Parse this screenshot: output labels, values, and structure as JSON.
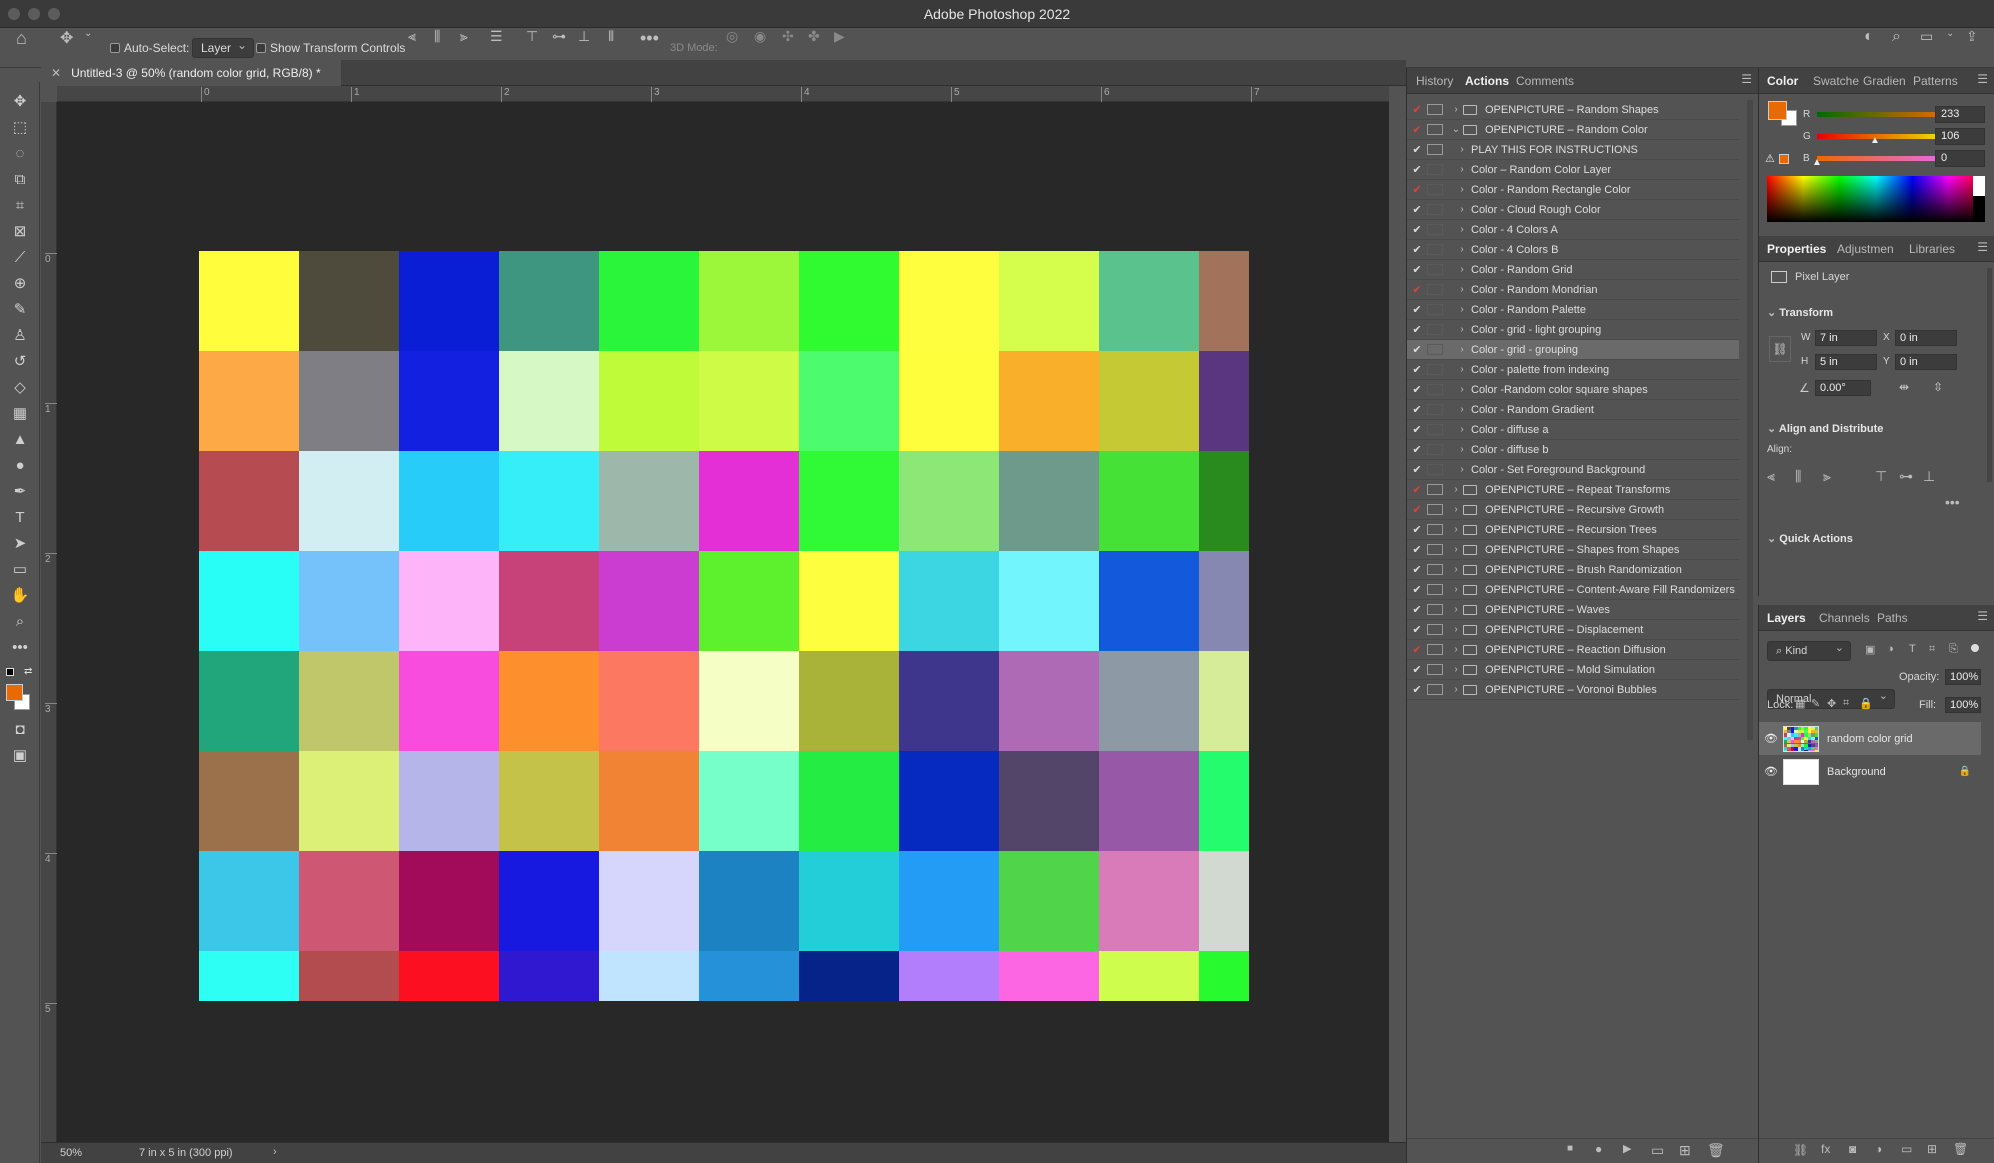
{
  "app": {
    "title": "Adobe Photoshop 2022"
  },
  "options_bar": {
    "auto_select_label": "Auto-Select:",
    "auto_select_value": "Layer",
    "show_transform_label": "Show Transform Controls",
    "mode_3d_label": "3D Mode:"
  },
  "document": {
    "tab_title": "Untitled-3 @ 50% (random color grid, RGB/8) *",
    "zoom": "50%",
    "doc_size": "7 in x 5 in (300 ppi)",
    "ruler_h": [
      "0",
      "1",
      "2",
      "3",
      "4",
      "5",
      "6",
      "7"
    ],
    "ruler_v": [
      "0",
      "1",
      "2",
      "3",
      "4",
      "5"
    ],
    "grid": {
      "cols": 10.5,
      "rows": 7.5,
      "colors": [
        [
          "#fffd3c",
          "#4e4b3c",
          "#0a1ed6",
          "#3e9680",
          "#2af53a",
          "#9cf63a",
          "#30fb30",
          "#fefd3e",
          "#d5fd4c",
          "#59c28d",
          "#a2725a"
        ],
        [
          "#fdaa46",
          "#7f7e84",
          "#1320df",
          "#d6f8c4",
          "#bffb39",
          "#cefb46",
          "#4dfc6e",
          "#fefe3c",
          "#f9af2a",
          "#c5c934",
          "#5b3680"
        ],
        [
          "#b64c52",
          "#d3eef2",
          "#28ccf9",
          "#36eef8",
          "#9db8aa",
          "#e42fd6",
          "#30fa35",
          "#8de776",
          "#6e9a8b",
          "#46e137",
          "#298a1d"
        ],
        [
          "#28fdf6",
          "#75c1fa",
          "#fdb4f8",
          "#c8427a",
          "#cb3dd1",
          "#5df02c",
          "#fdfe3d",
          "#3cd6e2",
          "#72f5fd",
          "#1259dc",
          "#8688b1"
        ],
        [
          "#21a67c",
          "#c0c76a",
          "#f84cde",
          "#fd902c",
          "#fd7861",
          "#f5fec4",
          "#a9b339",
          "#3e358d",
          "#af6ab6",
          "#8d9aa5",
          "#d6ec98"
        ],
        [
          "#9a714a",
          "#dcf078",
          "#b6b5ea",
          "#c4c248",
          "#f18335",
          "#77ffc9",
          "#25ec42",
          "#0629bf",
          "#524569",
          "#9858a8",
          "#24fb6d"
        ],
        [
          "#3cc6e8",
          "#ce5873",
          "#a10b5a",
          "#1719e1",
          "#d6d6fd",
          "#1c82c1",
          "#24ced8",
          "#239cf5",
          "#50d54a",
          "#d97ab9",
          "#d2d9d0"
        ],
        [
          "#2efff5",
          "#b24c4f",
          "#fd0f22",
          "#3018d0",
          "#c0e4fd",
          "#2491d9",
          "#06238a",
          "#b27efc",
          "#fd66e3",
          "#cffd4e",
          "#27fa2e"
        ]
      ]
    }
  },
  "actions_panel": {
    "tabs": [
      "History",
      "Actions",
      "Comments"
    ],
    "rows": [
      {
        "check": "red",
        "dialog": true,
        "expanded": false,
        "folder": true,
        "indent": 0,
        "label": "OPENPICTURE – Random Shapes"
      },
      {
        "check": "red",
        "dialog": true,
        "expanded": true,
        "folder": true,
        "indent": 0,
        "label": "OPENPICTURE – Random Color"
      },
      {
        "check": "white",
        "dialog": true,
        "expanded": false,
        "folder": false,
        "indent": 1,
        "label": "PLAY THIS FOR INSTRUCTIONS"
      },
      {
        "check": "white",
        "dialog": false,
        "expanded": false,
        "folder": false,
        "indent": 1,
        "label": "Color – Random Color Layer"
      },
      {
        "check": "red",
        "dialog": false,
        "expanded": false,
        "folder": false,
        "indent": 1,
        "label": "Color - Random Rectangle Color"
      },
      {
        "check": "white",
        "dialog": false,
        "expanded": false,
        "folder": false,
        "indent": 1,
        "label": "Color - Cloud Rough Color"
      },
      {
        "check": "white",
        "dialog": false,
        "expanded": false,
        "folder": false,
        "indent": 1,
        "label": "Color - 4 Colors A"
      },
      {
        "check": "white",
        "dialog": false,
        "expanded": false,
        "folder": false,
        "indent": 1,
        "label": "Color - 4 Colors B"
      },
      {
        "check": "white",
        "dialog": false,
        "expanded": false,
        "folder": false,
        "indent": 1,
        "label": "Color - Random Grid"
      },
      {
        "check": "red",
        "dialog": false,
        "expanded": false,
        "folder": false,
        "indent": 1,
        "label": "Color - Random Mondrian"
      },
      {
        "check": "white",
        "dialog": false,
        "expanded": false,
        "folder": false,
        "indent": 1,
        "label": "Color - Random Palette"
      },
      {
        "check": "white",
        "dialog": false,
        "expanded": false,
        "folder": false,
        "indent": 1,
        "label": "Color - grid - light grouping"
      },
      {
        "check": "white",
        "dialog": false,
        "expanded": false,
        "folder": false,
        "indent": 1,
        "label": "Color - grid - grouping",
        "selected": true
      },
      {
        "check": "white",
        "dialog": false,
        "expanded": false,
        "folder": false,
        "indent": 1,
        "label": "Color - palette from indexing"
      },
      {
        "check": "white",
        "dialog": false,
        "expanded": false,
        "folder": false,
        "indent": 1,
        "label": "Color -Random color square shapes"
      },
      {
        "check": "white",
        "dialog": false,
        "expanded": false,
        "folder": false,
        "indent": 1,
        "label": "Color - Random Gradient"
      },
      {
        "check": "white",
        "dialog": false,
        "expanded": false,
        "folder": false,
        "indent": 1,
        "label": "Color - diffuse a"
      },
      {
        "check": "white",
        "dialog": false,
        "expanded": false,
        "folder": false,
        "indent": 1,
        "label": "Color - diffuse b"
      },
      {
        "check": "white",
        "dialog": false,
        "expanded": false,
        "folder": false,
        "indent": 1,
        "label": "Color - Set Foreground Background"
      },
      {
        "check": "red",
        "dialog": true,
        "expanded": false,
        "folder": true,
        "indent": 0,
        "label": "OPENPICTURE – Repeat Transforms"
      },
      {
        "check": "red",
        "dialog": true,
        "expanded": false,
        "folder": true,
        "indent": 0,
        "label": "OPENPICTURE – Recursive Growth"
      },
      {
        "check": "white",
        "dialog": true,
        "expanded": false,
        "folder": true,
        "indent": 0,
        "label": "OPENPICTURE – Recursion Trees"
      },
      {
        "check": "white",
        "dialog": true,
        "expanded": false,
        "folder": true,
        "indent": 0,
        "label": "OPENPICTURE – Shapes from Shapes"
      },
      {
        "check": "white",
        "dialog": true,
        "expanded": false,
        "folder": true,
        "indent": 0,
        "label": "OPENPICTURE – Brush Randomization"
      },
      {
        "check": "white",
        "dialog": true,
        "expanded": false,
        "folder": true,
        "indent": 0,
        "label": "OPENPICTURE – Content-Aware Fill Randomizers"
      },
      {
        "check": "white",
        "dialog": true,
        "expanded": false,
        "folder": true,
        "indent": 0,
        "label": "OPENPICTURE – Waves"
      },
      {
        "check": "white",
        "dialog": true,
        "expanded": false,
        "folder": true,
        "indent": 0,
        "label": "OPENPICTURE – Displacement"
      },
      {
        "check": "red",
        "dialog": true,
        "expanded": false,
        "folder": true,
        "indent": 0,
        "label": "OPENPICTURE – Reaction Diffusion"
      },
      {
        "check": "white",
        "dialog": true,
        "expanded": false,
        "folder": true,
        "indent": 0,
        "label": "OPENPICTURE – Mold Simulation"
      },
      {
        "check": "white",
        "dialog": true,
        "expanded": false,
        "folder": true,
        "indent": 0,
        "label": "OPENPICTURE – Voronoi Bubbles"
      }
    ]
  },
  "color_panel": {
    "tabs": [
      "Color",
      "Swatche",
      "Gradien",
      "Patterns"
    ],
    "r_label": "R",
    "g_label": "G",
    "b_label": "B",
    "r": "233",
    "g": "106",
    "b": "0",
    "r_fraction": 0.914,
    "g_fraction": 0.416,
    "b_fraction": 0.0,
    "foreground": "#e96a00"
  },
  "properties_panel": {
    "tabs": [
      "Properties",
      "Adjustmen",
      "Libraries"
    ],
    "layer_type": "Pixel Layer",
    "transform_title": "Transform",
    "w_label": "W",
    "w": "7 in",
    "x_label": "X",
    "x": "0 in",
    "h_label": "H",
    "h": "5 in",
    "y_label": "Y",
    "y": "0 in",
    "angle": "0.00°",
    "align_title": "Align and Distribute",
    "align_label": "Align:",
    "quick_title": "Quick Actions"
  },
  "layers_panel": {
    "tabs": [
      "Layers",
      "Channels",
      "Paths"
    ],
    "kind": "Kind",
    "blend": "Normal",
    "opacity_label": "Opacity:",
    "opacity": "100%",
    "lock_label": "Lock:",
    "fill_label": "Fill:",
    "fill": "100%",
    "layers": [
      {
        "name": "random color grid",
        "selected": true
      },
      {
        "name": "Background",
        "selected": false
      }
    ]
  }
}
